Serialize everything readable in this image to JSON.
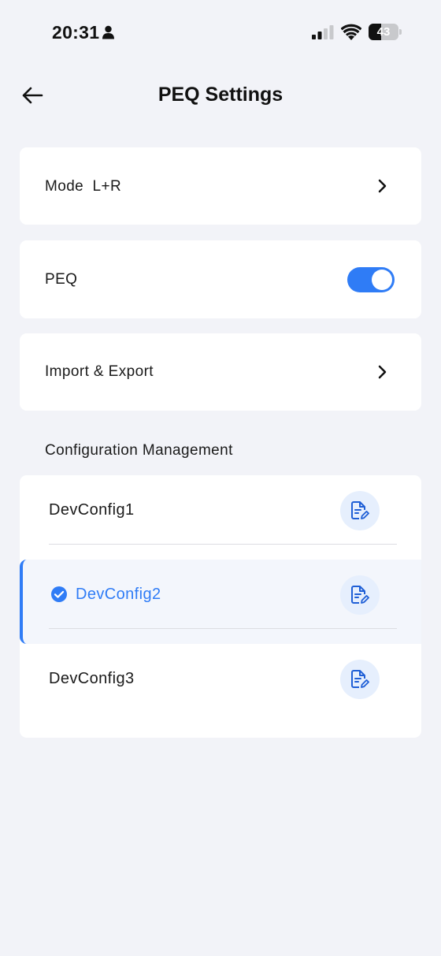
{
  "status_bar": {
    "time": "20:31",
    "battery_level": 43,
    "battery_label": "43"
  },
  "header": {
    "title": "PEQ Settings",
    "back_icon": "arrow-left-icon"
  },
  "mode_row": {
    "label": "Mode",
    "value": "L+R"
  },
  "peq_row": {
    "label": "PEQ",
    "enabled": true
  },
  "import_export_row": {
    "label": "Import & Export"
  },
  "configuration": {
    "section_title": "Configuration Management",
    "items": [
      {
        "name": "DevConfig1",
        "selected": false
      },
      {
        "name": "DevConfig2",
        "selected": true
      },
      {
        "name": "DevConfig3",
        "selected": false
      }
    ]
  },
  "colors": {
    "accent": "#2f7cf6",
    "background": "#f2f3f8",
    "edit_button_bg": "#e6effd"
  }
}
